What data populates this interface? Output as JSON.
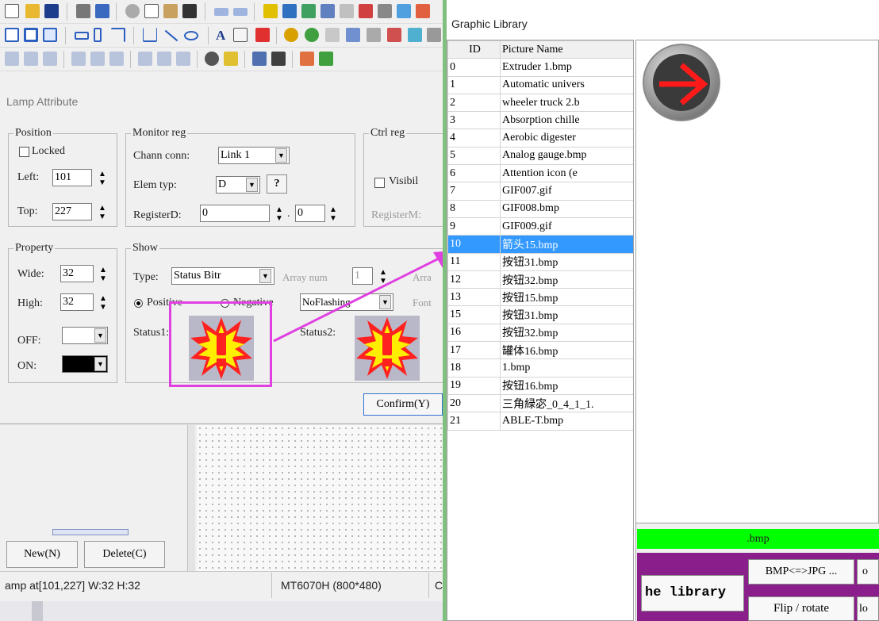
{
  "toolbar_icons": {
    "row1": [
      "new-file",
      "open-folder",
      "save-disk",
      "print",
      "print-preview",
      "cut",
      "copy",
      "paste",
      "find",
      "undo",
      "redo",
      "window-a",
      "window-b",
      "window-c"
    ],
    "row2": [
      "rect-a",
      "rect-b",
      "rect-c",
      "shape-1",
      "shape-2",
      "shape-3",
      "ruler",
      "line",
      "ellipse",
      "text-A",
      "number-999",
      "lamp-red",
      "disc",
      "palette"
    ],
    "row3": [
      "tool-1",
      "tool-2",
      "tool-3",
      "tool-4",
      "tool-5",
      "tool-6",
      "tool-7",
      "tool-8",
      "tool-9",
      "tool-10",
      "tool-11",
      "tool-12",
      "tool-13"
    ]
  },
  "lamp_dialog": {
    "title": "Lamp Attribute",
    "position": {
      "label": "Position",
      "locked_label": "Locked",
      "left_label": "Left:",
      "left_value": "101",
      "top_label": "Top:",
      "top_value": "227"
    },
    "monitor": {
      "label": "Monitor reg",
      "chann_label": "Chann conn:",
      "chann_value": "Link 1",
      "elem_label": "Elem typ:",
      "elem_value": "D",
      "help": "?",
      "reg_label": "RegisterD:",
      "reg_value": "0",
      "reg_dot": ".",
      "reg_sub": "0"
    },
    "ctrl": {
      "label": "Ctrl reg",
      "visible_label": "Visibil",
      "reg_label": "RegisterM:"
    },
    "property": {
      "label": "Property",
      "wide_label": "Wide:",
      "wide_value": "32",
      "high_label": "High:",
      "high_value": "32",
      "off_label": "OFF:",
      "on_label": "ON:"
    },
    "show": {
      "label": "Show",
      "type_label": "Type:",
      "type_value": "Status Bitr",
      "array_label": "Array num",
      "array_value": "1",
      "array2_label": "Arra",
      "positive_label": "Positive",
      "negative_label": "Negative",
      "flash_value": "NoFlashing",
      "font_label": "Font",
      "status1_label": "Status1:",
      "status2_label": "Status2:"
    },
    "confirm_label": "Confirm(Y)"
  },
  "left_buttons": {
    "new_label": "New(N)",
    "delete_label": "Delete(C)"
  },
  "statusbar": {
    "left_text": "amp at[101,227] W:32  H:32",
    "model_text": "MT6070H (800*480)",
    "extra_text": "C"
  },
  "library": {
    "title": "Graphic Library",
    "columns": [
      "ID",
      "Picture Name"
    ],
    "rows": [
      [
        "0",
        "Extruder 1.bmp"
      ],
      [
        "1",
        "Automatic univers"
      ],
      [
        "2",
        "wheeler truck 2.b"
      ],
      [
        "3",
        "Absorption chille"
      ],
      [
        "4",
        "Aerobic digester"
      ],
      [
        "5",
        "Analog gauge.bmp"
      ],
      [
        "6",
        "Attention icon (e"
      ],
      [
        "7",
        "GIF007.gif"
      ],
      [
        "8",
        "GIF008.bmp"
      ],
      [
        "9",
        "GIF009.gif"
      ],
      [
        "10",
        "箭头15.bmp"
      ],
      [
        "11",
        "按钮31.bmp"
      ],
      [
        "12",
        "按钮32.bmp"
      ],
      [
        "13",
        "按钮15.bmp"
      ],
      [
        "15",
        "按钮31.bmp"
      ],
      [
        "16",
        "按钮32.bmp"
      ],
      [
        "17",
        "罐体16.bmp"
      ],
      [
        "18",
        "1.bmp"
      ],
      [
        "19",
        "按钮16.bmp"
      ],
      [
        "20",
        "三角緑宓_0_4_1_1."
      ],
      [
        "21",
        "ABLE-T.bmp"
      ]
    ],
    "selected_index": 10,
    "bmp_label": ".bmp",
    "library_button": "he library",
    "bmp_jpg_button": "BMP<=>JPG ...",
    "flip_button": "Flip / rotate",
    "cut_btn_1": "o",
    "cut_btn_2": "lo"
  },
  "colors": {
    "selected": "#3399ff",
    "accent_green": "#00ff00",
    "annotation": "#e040e0",
    "arrow_red": "#e02020"
  }
}
